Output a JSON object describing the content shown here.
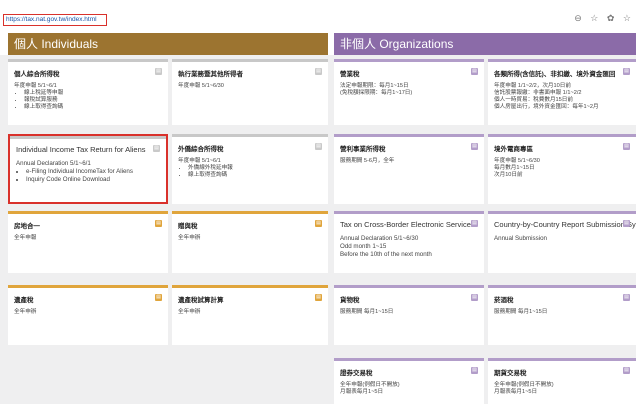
{
  "browser": {
    "url": "https://tax.nat.gov.tw/index.html",
    "icons": "⊖ ☆ ✿ ☆"
  },
  "sections": {
    "individuals": "個人 Individuals",
    "organizations": "非個人 Organizations"
  },
  "cards": {
    "c1": {
      "title": "個人綜合所得稅",
      "lines": [
        "年度申報 5/1~6/1"
      ],
      "bullets": [
        "線上稅延等申報",
        "報稅試算服務",
        "線上取得查詢碼"
      ]
    },
    "c2": {
      "title": "執行業務暨其他所得者",
      "lines": [
        "年度申報 5/1~6/30"
      ],
      "bullets": []
    },
    "c3": {
      "title": "營業稅",
      "lines": [
        "法定申報期限：每月1~15日",
        "(免稅額採限期：每月1~17日)"
      ],
      "bullets": []
    },
    "c4": {
      "title": "各類所得(含信託)、非扣繳、境外資金匯回",
      "lines": [
        "年度申報 1/1~2/2，次月10日前",
        "信託股票報繳：非書面申報 1/1~2/2",
        "個人一時貿易：稅費數月15日前",
        "個人房屋出行，境外資金匯回：每年1~2月"
      ],
      "bullets": []
    },
    "c5": {
      "title": "Individual Income Tax Return for Aliens",
      "lines": [
        "Annual Declaration 5/1~6/1"
      ],
      "bullets": [
        "e-Filing Individual IncomeTax for Aliens",
        "Inquiry Code Online Download"
      ]
    },
    "c6": {
      "title": "外僑綜合所得稅",
      "lines": [
        "年度申報 5/1~6/1"
      ],
      "bullets": [
        "外僑線外稅延申報",
        "線上取得查詢碼"
      ]
    },
    "c7": {
      "title": "營利事業所得稅",
      "lines": [
        "服務期間 5-6月，全年"
      ],
      "bullets": []
    },
    "c8": {
      "title": "境外電商專區",
      "lines": [
        "年度申報 5/1~6/30",
        "每月數月1~15日",
        "次月10日前"
      ],
      "bullets": []
    },
    "c9": {
      "title": "房地合一",
      "lines": [
        "全年申報"
      ],
      "bullets": []
    },
    "c10": {
      "title": "贈與稅",
      "lines": [
        "全年申辦"
      ],
      "bullets": []
    },
    "c11": {
      "title": "Tax on Cross-Border Electronic Services",
      "lines": [
        "Annual Declaration 5/1~6/30",
        "Odd month 1~15",
        "Before the 10th of the next month"
      ],
      "bullets": []
    },
    "c12": {
      "title": "Country-by-Country Report Submission System",
      "lines": [
        "Annual Submission"
      ],
      "bullets": []
    },
    "c13": {
      "title": "遺產稅",
      "lines": [
        "全年申辦"
      ],
      "bullets": []
    },
    "c14": {
      "title": "遺產稅試算計算",
      "lines": [
        "全年申辦"
      ],
      "bullets": []
    },
    "c15": {
      "title": "貨物稅",
      "lines": [
        "服務期間 每月1~15日"
      ],
      "bullets": []
    },
    "c16": {
      "title": "菸酒稅",
      "lines": [
        "服務期間 每月1~15日"
      ],
      "bullets": []
    },
    "c17": {
      "title": "證券交易稅",
      "lines": [
        "全年申報(例假日不開放)",
        "月報表每月1~5日"
      ],
      "bullets": []
    },
    "c18": {
      "title": "期貨交易稅",
      "lines": [
        "全年申報(例假日不開放)",
        "月報表每月1~5日"
      ],
      "bullets": []
    }
  },
  "colors": {
    "individual": "#9c7430",
    "organization": "#8b6ba8",
    "gold": "#e0a53c",
    "highlight": "#d9312b"
  }
}
